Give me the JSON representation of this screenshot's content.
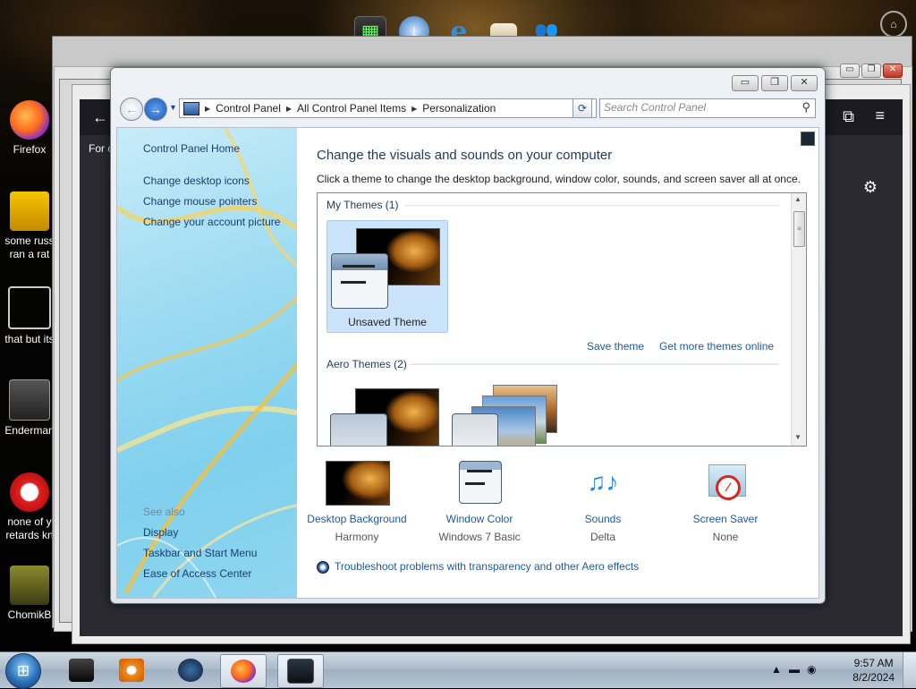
{
  "desktop": {
    "icons": [
      {
        "label": "Firefox"
      },
      {
        "label": "some russ\nran a rat"
      },
      {
        "label": "that but its"
      },
      {
        "label": "Enderman"
      },
      {
        "label": "none of y\nretards kn"
      },
      {
        "label": "ChomikB"
      }
    ],
    "firefox_partial_text": "For c"
  },
  "window": {
    "caption": {
      "minimize": "▭",
      "maximize": "❐",
      "close": "✕"
    },
    "breadcrumbs": [
      "Control Panel",
      "All Control Panel Items",
      "Personalization"
    ],
    "search_placeholder": "Search Control Panel"
  },
  "left_pane": {
    "home": "Control Panel Home",
    "links": [
      "Change desktop icons",
      "Change mouse pointers",
      "Change your account picture"
    ],
    "see_also_heading": "See also",
    "see_also": [
      "Display",
      "Taskbar and Start Menu",
      "Ease of Access Center"
    ]
  },
  "main": {
    "heading": "Change the visuals and sounds on your computer",
    "subtext": "Click a theme to change the desktop background, window color, sounds, and screen saver all at once.",
    "my_themes_title": "My Themes (1)",
    "unsaved_theme_label": "Unsaved Theme",
    "save_theme": "Save theme",
    "get_more_themes": "Get more themes online",
    "aero_themes_title": "Aero Themes (2)"
  },
  "customize": [
    {
      "label": "Desktop Background",
      "value": "Harmony"
    },
    {
      "label": "Window Color",
      "value": "Windows 7 Basic"
    },
    {
      "label": "Sounds",
      "value": "Delta"
    },
    {
      "label": "Screen Saver",
      "value": "None"
    }
  ],
  "troubleshoot_link": "Troubleshoot problems with transparency and other Aero effects",
  "taskbar": {
    "time": "9:57 AM",
    "date": "8/2/2024"
  }
}
